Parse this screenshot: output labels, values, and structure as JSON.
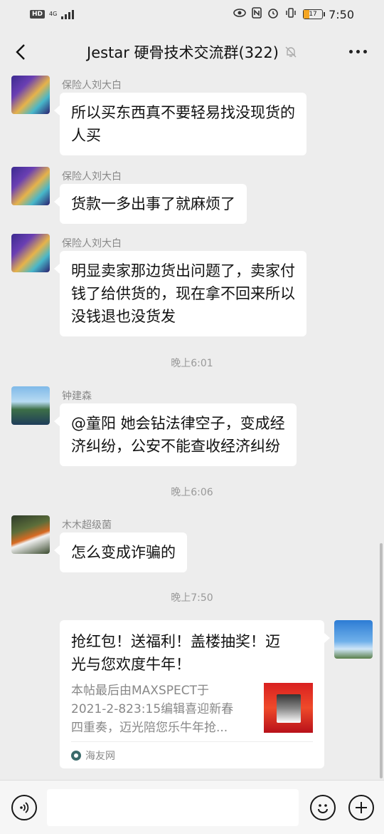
{
  "status_bar": {
    "hd": "HD",
    "network": "4G",
    "battery": "17",
    "time": "7:50"
  },
  "header": {
    "title": "Jestar 硬骨技术交流群(322)"
  },
  "messages": [
    {
      "sender": "保险人刘大白",
      "text_lines": [
        "所以买东西真不要轻易找没现货的",
        "人买"
      ]
    },
    {
      "sender": "保险人刘大白",
      "text_lines": [
        "货款一多出事了就麻烦了"
      ]
    },
    {
      "sender": "保险人刘大白",
      "text_lines": [
        "明显卖家那边货出问题了，卖家付",
        "钱了给供货的，现在拿不回来所以",
        "没钱退也没货发"
      ]
    },
    {
      "time": "晚上6:01"
    },
    {
      "sender": "钟建森",
      "text_lines": [
        "@童阳  她会钻法律空子，变成经",
        "济纠纷，公安不能查收经济纠纷"
      ]
    },
    {
      "time": "晚上6:06"
    },
    {
      "sender": "木木超级菌",
      "text_lines": [
        "怎么变成诈骗的"
      ]
    },
    {
      "time": "晚上7:50"
    }
  ],
  "card": {
    "title_lines": [
      "抢红包！送福利！盖楼抽奖！迈",
      "光与您欢度牛年！"
    ],
    "desc_lines": [
      "本帖最后由MAXSPECT于",
      "2021-2-823:15编辑喜迎新春",
      "四重奏，迈光陪您乐牛年抢..."
    ],
    "source": "海友网"
  },
  "input": {
    "placeholder": ""
  }
}
